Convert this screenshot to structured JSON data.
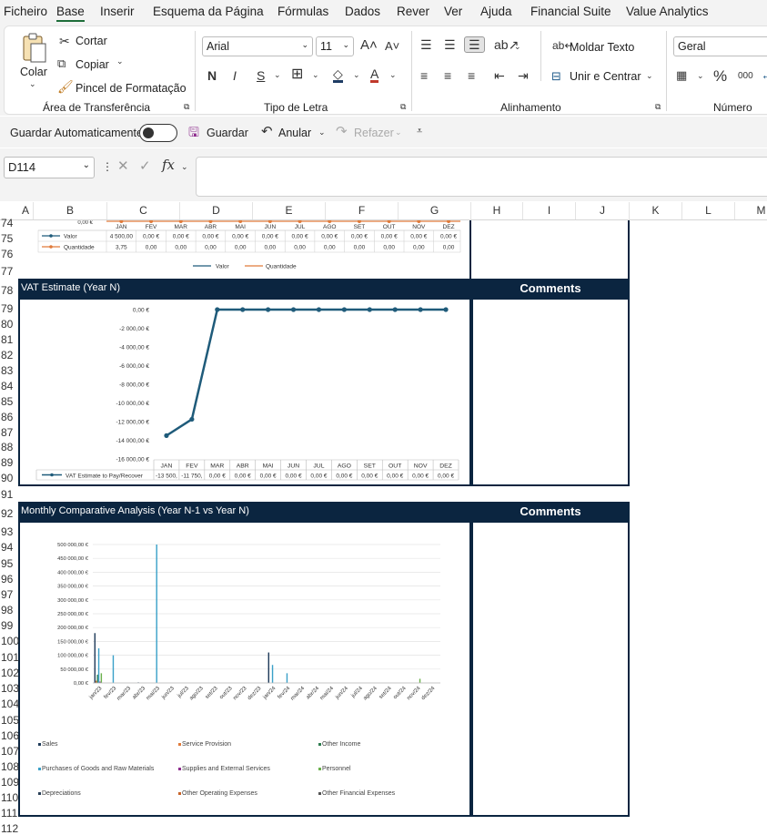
{
  "menu": [
    "Ficheiro",
    "Base",
    "Inserir",
    "Esquema da Página",
    "Fórmulas",
    "Dados",
    "Rever",
    "Ver",
    "Ajuda",
    "Financial Suite",
    "Value Analytics"
  ],
  "ribbon": {
    "paste": "Colar",
    "cut": "Cortar",
    "copy": "Copiar",
    "format_painter": "Pincel de Formatação",
    "font_name": "Arial",
    "font_size": "11",
    "wrap": "Moldar Texto",
    "merge": "Unir e Centrar",
    "number_format": "Geral",
    "thousands": "000",
    "groups": {
      "clipboard": "Área de Transferência",
      "font": "Tipo de Letra",
      "alignment": "Alinhamento",
      "number": "Número"
    }
  },
  "qat": {
    "autosave": "Guardar Automaticamente",
    "save": "Guardar",
    "undo": "Anular",
    "redo": "Refazer"
  },
  "formula_bar": {
    "name_box": "D114",
    "fx": "fx"
  },
  "columns": [
    "A",
    "B",
    "C",
    "D",
    "E",
    "F",
    "G",
    "H",
    "I",
    "J",
    "K",
    "L",
    "M"
  ],
  "rows": [
    "74",
    "75",
    "76",
    "77",
    "78",
    "79",
    "80",
    "81",
    "82",
    "83",
    "84",
    "85",
    "86",
    "87",
    "88",
    "89",
    "90",
    "91",
    "92",
    "93",
    "94",
    "95",
    "96",
    "97",
    "98",
    "99",
    "100",
    "101",
    "102",
    "103",
    "104",
    "105",
    "106",
    "107",
    "108",
    "109",
    "110",
    "111",
    "112"
  ],
  "section1": {
    "months": [
      "JAN",
      "FEV",
      "MAR",
      "ABR",
      "MAI",
      "JUN",
      "JUL",
      "AGO",
      "SET",
      "OUT",
      "NOV",
      "DEZ"
    ],
    "zero_label": "0,00 €",
    "rows": [
      {
        "name": "Valor",
        "values": [
          "4 500,00",
          "0,00 €",
          "0,00 €",
          "0,00 €",
          "0,00 €",
          "0,00 €",
          "0,00 €",
          "0,00 €",
          "0,00 €",
          "0,00 €",
          "0,00 €",
          "0,00 €"
        ]
      },
      {
        "name": "Quantidade",
        "values": [
          "3,75",
          "0,00",
          "0,00",
          "0,00",
          "0,00",
          "0,00",
          "0,00",
          "0,00",
          "0,00",
          "0,00",
          "0,00",
          "0,00"
        ]
      }
    ],
    "legend": [
      "Valor",
      "Quantidade"
    ]
  },
  "vat": {
    "title": "VAT Estimate (Year N)",
    "comments": "Comments",
    "series_label": "VAT Estimate to Pay/Recover",
    "table_values": [
      "-13 500,",
      "-11 750,",
      "0,00 €",
      "0,00 €",
      "0,00 €",
      "0,00 €",
      "0,00 €",
      "0,00 €",
      "0,00 €",
      "0,00 €",
      "0,00 €",
      "0,00 €"
    ]
  },
  "monthly": {
    "title": "Monthly Comparative Analysis (Year N-1 vs Year N)",
    "comments": "Comments"
  },
  "chart_data": [
    {
      "type": "line",
      "categories": [
        "JAN",
        "FEV",
        "MAR",
        "ABR",
        "MAI",
        "JUN",
        "JUL",
        "AGO",
        "SET",
        "OUT",
        "NOV",
        "DEZ"
      ],
      "series": [
        {
          "name": "VAT Estimate to Pay/Recover",
          "values": [
            -13500,
            -11750,
            0,
            0,
            0,
            0,
            0,
            0,
            0,
            0,
            0,
            0
          ]
        }
      ],
      "ylim": [
        -16000,
        0
      ],
      "yticks": [
        "0,00 €",
        "-2 000,00 €",
        "-4 000,00 €",
        "-6 000,00 €",
        "-8 000,00 €",
        "-10 000,00 €",
        "-12 000,00 €",
        "-14 000,00 €",
        "-16 000,00 €"
      ],
      "color": "#1f5b7a"
    },
    {
      "type": "bar",
      "categories": [
        "jan/23",
        "fev/23",
        "mar/23",
        "abr/23",
        "mai/23",
        "jun/23",
        "jul/23",
        "ago/23",
        "set/23",
        "out/23",
        "nov/23",
        "dez/23",
        "jan/24",
        "fev/24",
        "mar/24",
        "abr/24",
        "mai/24",
        "jun/24",
        "jul/24",
        "ago/24",
        "set/24",
        "out/24",
        "nov/24",
        "dez/24"
      ],
      "ylim": [
        0,
        500000
      ],
      "yticks": [
        "500 000,00 €",
        "450 000,00 €",
        "400 000,00 €",
        "350 000,00 €",
        "300 000,00 €",
        "250 000,00 €",
        "200 000,00 €",
        "150 000,00 €",
        "100 000,00 €",
        "50 000,00 €",
        "0,00 €"
      ],
      "series": [
        {
          "name": "Sales",
          "color": "#1f3b5a",
          "values": [
            180000,
            0,
            0,
            2000,
            0,
            0,
            0,
            0,
            0,
            0,
            0,
            0,
            110000,
            0,
            0,
            0,
            0,
            0,
            0,
            0,
            0,
            0,
            0,
            0
          ]
        },
        {
          "name": "Service Provision",
          "color": "#e07a3a",
          "values": [
            8000,
            0,
            0,
            0,
            0,
            0,
            0,
            0,
            0,
            0,
            0,
            0,
            0,
            0,
            0,
            0,
            0,
            0,
            0,
            0,
            0,
            0,
            0,
            0
          ]
        },
        {
          "name": "Other Income",
          "color": "#2e7d4f",
          "values": [
            30000,
            0,
            0,
            0,
            0,
            0,
            0,
            0,
            0,
            0,
            0,
            0,
            0,
            0,
            0,
            0,
            0,
            0,
            0,
            0,
            0,
            0,
            0,
            0
          ]
        },
        {
          "name": "Purchases of Goods and Raw Materials",
          "color": "#3aa0c8",
          "values": [
            125000,
            100000,
            0,
            0,
            500000,
            0,
            0,
            0,
            0,
            0,
            0,
            0,
            65000,
            35000,
            0,
            0,
            0,
            0,
            0,
            0,
            0,
            0,
            0,
            0
          ]
        },
        {
          "name": "Supplies and External Services",
          "color": "#8e2c8e",
          "values": [
            5000,
            0,
            0,
            0,
            0,
            0,
            0,
            0,
            0,
            0,
            0,
            0,
            0,
            0,
            0,
            0,
            0,
            0,
            0,
            0,
            0,
            0,
            0,
            0
          ]
        },
        {
          "name": "Personnel",
          "color": "#6ab04c",
          "values": [
            35000,
            0,
            0,
            0,
            0,
            0,
            0,
            0,
            0,
            0,
            0,
            0,
            0,
            0,
            0,
            0,
            0,
            0,
            0,
            0,
            0,
            0,
            15000,
            0
          ]
        },
        {
          "name": "Depreciations",
          "color": "#2a4058",
          "values": [
            0,
            0,
            0,
            0,
            0,
            0,
            0,
            0,
            0,
            0,
            0,
            0,
            0,
            0,
            0,
            0,
            0,
            0,
            0,
            0,
            0,
            0,
            0,
            0
          ]
        },
        {
          "name": "Other Operating Expenses",
          "color": "#c8642a",
          "values": [
            0,
            0,
            0,
            0,
            0,
            0,
            0,
            0,
            0,
            0,
            0,
            0,
            0,
            0,
            0,
            0,
            0,
            0,
            0,
            0,
            0,
            0,
            0,
            0
          ]
        },
        {
          "name": "Other Financial Expenses",
          "color": "#555555",
          "values": [
            0,
            0,
            0,
            0,
            0,
            0,
            0,
            0,
            0,
            0,
            0,
            0,
            0,
            0,
            0,
            0,
            0,
            0,
            0,
            0,
            0,
            0,
            0,
            0
          ]
        }
      ]
    }
  ]
}
